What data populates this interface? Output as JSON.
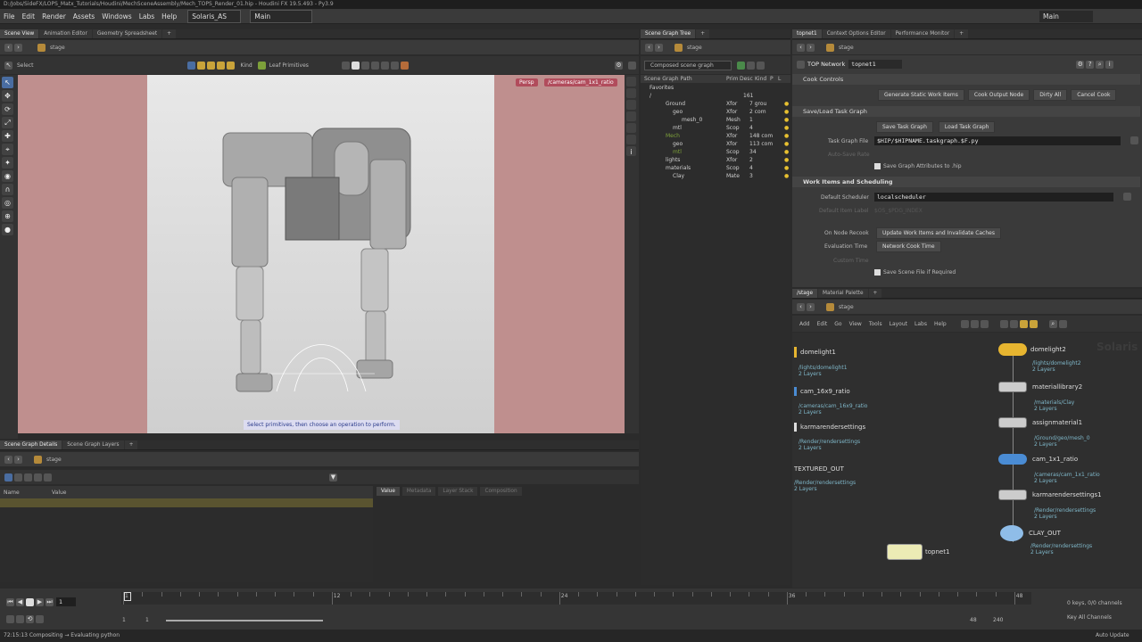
{
  "window_title": "D:/Jobs/SideFX/LOPS_Matx_Tutorials/Houdini/MechSceneAssembly/Mech_TOPS_Render_01.hip - Houdini FX 19.5.493 - Py3.9",
  "menu": [
    "File",
    "Edit",
    "Render",
    "Assets",
    "Windows",
    "Labs",
    "Help"
  ],
  "desktop": "Solaris_AS",
  "context": "Main",
  "right_context": "Main",
  "viewport": {
    "tabs": [
      "Scene View",
      "Animation Editor",
      "Geometry Spreadsheet"
    ],
    "path": "stage",
    "tool": "Select",
    "kind_label": "Kind",
    "kind_value": "Leaf Primitives",
    "persp": "Persp",
    "camera": "/cameras/cam_1x1_ratio",
    "hint": "Select primitives, then choose an operation to perform."
  },
  "scene_graph_tree": {
    "tab": "Scene Graph Tree",
    "path": "stage",
    "dropdown": "Composed scene graph",
    "headers": [
      "Scene Graph Path",
      "Prim",
      "Desc",
      "Kind",
      "P",
      "L"
    ],
    "rows": [
      {
        "name": "Favorites",
        "type": "",
        "desc": ""
      },
      {
        "name": "/",
        "type": "",
        "desc": "161"
      },
      {
        "name": "Ground",
        "type": "Xfor",
        "desc": "7 grou"
      },
      {
        "name": "geo",
        "type": "Xfor",
        "desc": "2 com"
      },
      {
        "name": "mesh_0",
        "type": "Mesh",
        "desc": "1"
      },
      {
        "name": "mtl",
        "type": "Scop",
        "desc": "4"
      },
      {
        "name": "Mech",
        "type": "Xfor",
        "desc": "148 com"
      },
      {
        "name": "geo",
        "type": "Xfor",
        "desc": "113 com"
      },
      {
        "name": "mtl",
        "type": "Scop",
        "desc": "34"
      },
      {
        "name": "lights",
        "type": "Xfor",
        "desc": "2"
      },
      {
        "name": "materials",
        "type": "Scop",
        "desc": "4"
      },
      {
        "name": "Clay",
        "type": "Mate",
        "desc": "3"
      }
    ]
  },
  "top_panel": {
    "tabs": [
      "topnet1",
      "Context Options Editor",
      "Performance Monitor"
    ],
    "path": "stage",
    "network_label": "TOP Network",
    "network_name": "topnet1",
    "cook_controls": "Cook Controls",
    "buttons": [
      "Generate Static Work Items",
      "Cook Output Node",
      "Dirty All",
      "Cancel Cook"
    ],
    "save_load": "Save/Load Task Graph",
    "save_btn": "Save Task Graph",
    "load_btn": "Load Task Graph",
    "task_graph_file_label": "Task Graph File",
    "task_graph_file": "$HIP/$HIPNAME.taskgraph.$F.py",
    "auto_save_rate": "Auto-Save Rate",
    "save_graph_attrs": "Save Graph Attributes to .hip",
    "work_items": "Work Items and Scheduling",
    "default_scheduler_label": "Default Scheduler",
    "default_scheduler": "localscheduler",
    "default_item_label": "Default Item Label",
    "default_item_value": "$OS_$PDG_INDEX",
    "on_node_recook_label": "On Node Recook",
    "on_node_recook": "Update Work Items and Invalidate Caches",
    "evaluation_time_label": "Evaluation Time",
    "evaluation_time": "Network Cook Time",
    "custom_time": "Custom Time",
    "save_scene": "Save Scene File if Required"
  },
  "network": {
    "tabs": [
      "/stage",
      "Material Palette"
    ],
    "path": "stage",
    "menu": [
      "Add",
      "Edit",
      "Go",
      "View",
      "Tools",
      "Layout",
      "Labs",
      "Help"
    ],
    "watermark": "Solaris",
    "left_nodes": [
      {
        "name": "domelight1",
        "path": "/lights/domelight1",
        "layers": "2 Layers",
        "color": "#e7b530"
      },
      {
        "name": "cam_16x9_ratio",
        "path": "/cameras/cam_16x9_ratio",
        "layers": "2 Layers",
        "color": "#4a8cd4"
      },
      {
        "name": "karmarendersettings",
        "path": "/Render/rendersettings",
        "layers": "2 Layers",
        "color": "#ddd"
      },
      {
        "name": "TEXTURED_OUT",
        "path": "/Render/rendersettings",
        "layers": "2 Layers",
        "color": "#888"
      }
    ],
    "right_nodes": [
      {
        "name": "domelight2",
        "path": "/lights/domelight2",
        "layers": "2 Layers",
        "color": "#e7b530"
      },
      {
        "name": "materiallibrary2",
        "path": "/materials/Clay",
        "layers": "2 Layers",
        "color": "#ddd"
      },
      {
        "name": "assignmaterial1",
        "path": "/Ground/geo/mesh_0",
        "layers": "2 Layers",
        "color": "#ddd"
      },
      {
        "name": "cam_1x1_ratio",
        "path": "/cameras/cam_1x1_ratio",
        "layers": "2 Layers",
        "color": "#4a8cd4"
      },
      {
        "name": "karmarendersettings1",
        "path": "/Render/rendersettings",
        "layers": "2 Layers",
        "color": "#ddd"
      },
      {
        "name": "CLAY_OUT",
        "path": "/Render/rendersettings",
        "layers": "2 Layers",
        "color": "#8fbde8"
      }
    ],
    "topnet": "topnet1"
  },
  "details": {
    "tabs": [
      "Scene Graph Details",
      "Scene Graph Layers"
    ],
    "path": "stage",
    "col_name": "Name",
    "col_value": "Value",
    "right_tabs": [
      "Value",
      "Metadata",
      "Layer Stack",
      "Composition"
    ]
  },
  "timeline": {
    "frame": "1",
    "start": "1",
    "start2": "1",
    "end": "48",
    "end2": "240",
    "ticks": [
      "1",
      "",
      "",
      "",
      "",
      "",
      "",
      "",
      "",
      "",
      "",
      "12",
      "",
      "",
      "",
      "",
      "",
      "",
      "",
      "",
      "",
      "",
      "",
      "24",
      "",
      "",
      "",
      "",
      "",
      "",
      "",
      "",
      "",
      "",
      "",
      "36",
      "",
      "",
      "",
      "",
      "",
      "",
      "",
      "",
      "",
      "",
      "",
      "48"
    ],
    "keys": "0 keys, 0/0 channels",
    "key_all": "Key All Channels",
    "auto_update": "Auto Update",
    "status": "72:15:13 Compositing → Evaluating python"
  }
}
